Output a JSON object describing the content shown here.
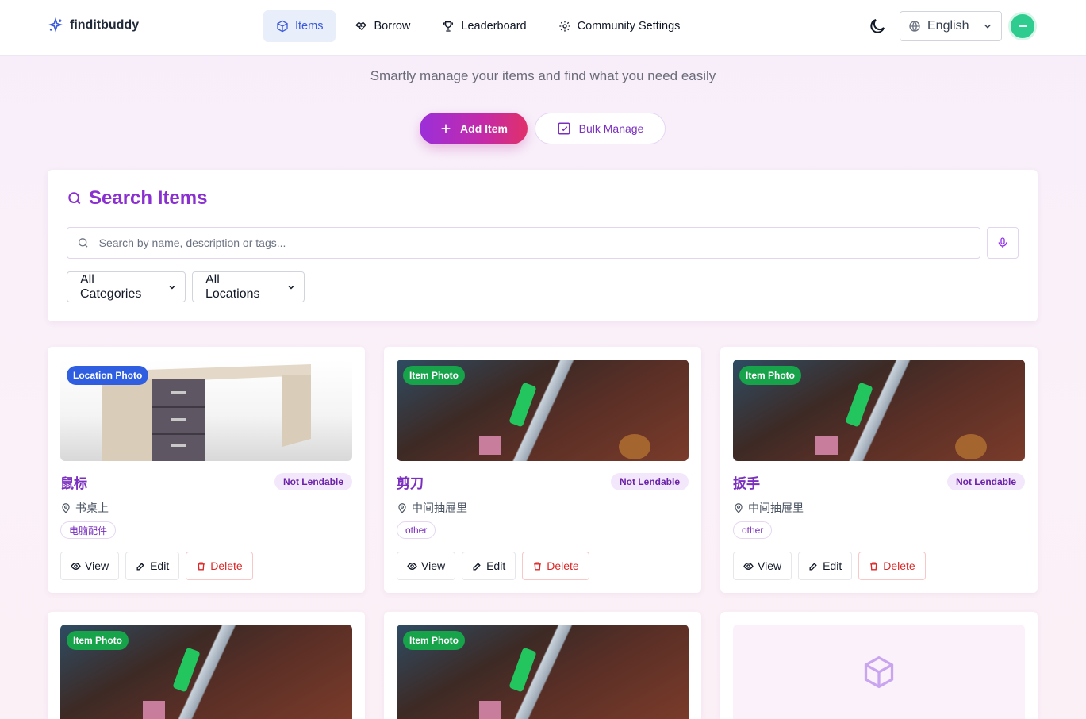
{
  "header": {
    "brand": "finditbuddy",
    "nav": [
      {
        "label": "Items",
        "icon": "cube-icon",
        "active": true
      },
      {
        "label": "Borrow",
        "icon": "handshake-icon",
        "active": false
      },
      {
        "label": "Leaderboard",
        "icon": "trophy-icon",
        "active": false
      },
      {
        "label": "Community Settings",
        "icon": "gear-icon",
        "active": false
      }
    ],
    "language": "English"
  },
  "hero": {
    "subtitle": "Smartly manage your items and find what you need easily",
    "add_label": "Add Item",
    "bulk_label": "Bulk Manage"
  },
  "search": {
    "title": "Search Items",
    "placeholder": "Search by name, description or tags...",
    "category": "All Categories",
    "location": "All Locations"
  },
  "items": [
    {
      "photo_label": "Location Photo",
      "name": "鼠标",
      "lendable": "Not Lendable",
      "location": "书桌上",
      "tag": "电脑配件"
    },
    {
      "photo_label": "Item Photo",
      "name": "剪刀",
      "lendable": "Not Lendable",
      "location": "中间抽屉里",
      "tag": "other"
    },
    {
      "photo_label": "Item Photo",
      "name": "扳手",
      "lendable": "Not Lendable",
      "location": "中间抽屉里",
      "tag": "other"
    },
    {
      "photo_label": "Item Photo"
    },
    {
      "photo_label": "Item Photo"
    }
  ],
  "card_actions": {
    "view": "View",
    "edit": "Edit",
    "delete": "Delete"
  },
  "colors": {
    "accent": "#8a2fd0",
    "nav_active": "#3b5bdb",
    "delete": "#dc2626",
    "badge_green": "#16a34a",
    "badge_blue": "#2f5fe0"
  }
}
